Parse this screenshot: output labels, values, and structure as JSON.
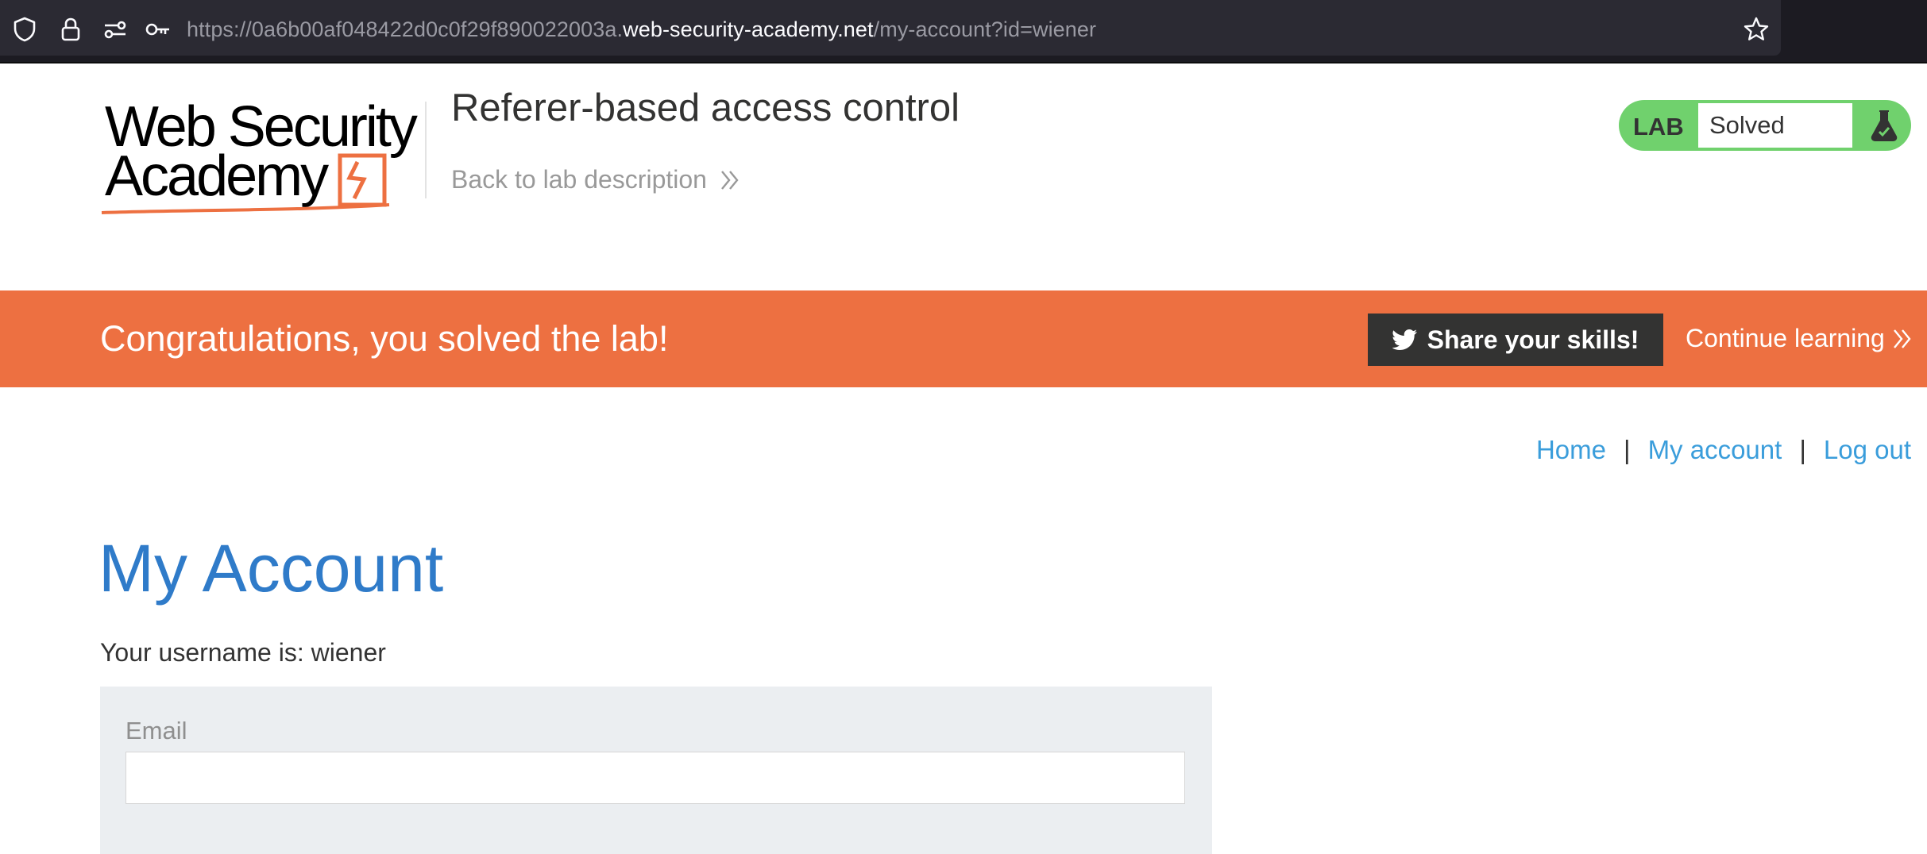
{
  "browser": {
    "url_prefix": "https://0a6b00af048422d0c0f29f890022003a.",
    "url_host": "web-security-academy.net",
    "url_path": "/my-account?id=wiener",
    "icons": [
      "shield-icon",
      "lock-icon",
      "site-permissions-icon",
      "key-icon",
      "bookmark-star-icon"
    ]
  },
  "header": {
    "logo_line1": "Web Security",
    "logo_line2": "Academy",
    "lab_title": "Referer-based access control",
    "back_link": "Back to lab description",
    "lab_badge_label": "LAB",
    "lab_status": "Solved",
    "flask_icon": "flask-icon"
  },
  "banner": {
    "message": "Congratulations, you solved the lab!",
    "share_button": "Share your skills!",
    "continue_link": "Continue learning",
    "color": "#ed7041"
  },
  "nav": {
    "home": "Home",
    "separator": "|",
    "my_account": "My account",
    "log_out": "Log out"
  },
  "main": {
    "title": "My Account",
    "username_line": "Your username is: wiener",
    "email_label": "Email",
    "email_value": ""
  },
  "colors": {
    "accent_blue": "#2f7bc9",
    "link_blue": "#3a9ddb",
    "badge_green": "#70d16d"
  }
}
